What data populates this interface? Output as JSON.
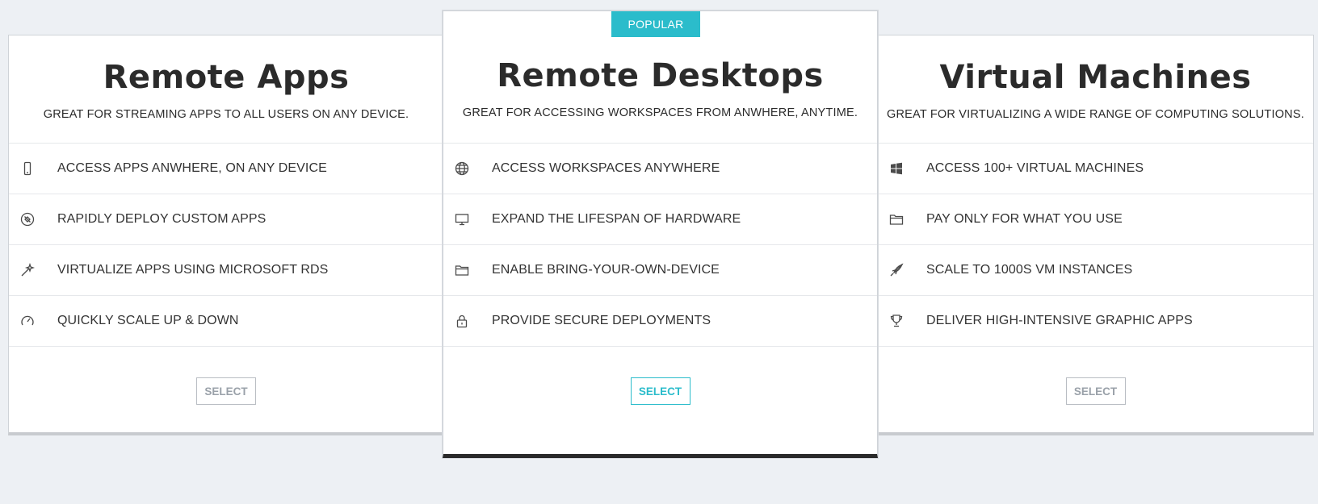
{
  "colors": {
    "accent": "#2bbccb",
    "background": "#edf0f4",
    "card": "#ffffff",
    "dark_bar": "#2a2a2a"
  },
  "plans": [
    {
      "title": "Remote Apps",
      "subtitle": "GREAT FOR STREAMING APPS TO ALL USERS ON ANY DEVICE.",
      "features": [
        {
          "icon": "mobile-icon",
          "label": "ACCESS APPS ANWHERE, ON ANY DEVICE"
        },
        {
          "icon": "compass-icon",
          "label": "RAPIDLY DEPLOY CUSTOM APPS"
        },
        {
          "icon": "magic-wand-icon",
          "label": "VIRTUALIZE APPS USING MICROSOFT RDS"
        },
        {
          "icon": "speedometer-icon",
          "label": "QUICKLY SCALE UP & DOWN"
        }
      ],
      "button": "SELECT"
    },
    {
      "badge": "POPULAR",
      "title": "Remote Desktops",
      "subtitle": "GREAT FOR ACCESSING WORKSPACES FROM ANWHERE, ANYTIME.",
      "features": [
        {
          "icon": "globe-icon",
          "label": "ACCESS WORKSPACES ANYWHERE"
        },
        {
          "icon": "monitor-icon",
          "label": "EXPAND THE LIFESPAN OF HARDWARE"
        },
        {
          "icon": "folder-icon",
          "label": "ENABLE BRING-YOUR-OWN-DEVICE"
        },
        {
          "icon": "lock-icon",
          "label": "PROVIDE SECURE DEPLOYMENTS"
        }
      ],
      "button": "SELECT"
    },
    {
      "title": "Virtual Machines",
      "subtitle": "GREAT FOR VIRTUALIZING A WIDE RANGE OF COMPUTING SOLUTIONS.",
      "features": [
        {
          "icon": "windows-icon",
          "label": "ACCESS 100+ VIRTUAL MACHINES"
        },
        {
          "icon": "folder-icon",
          "label": "PAY ONLY FOR WHAT YOU USE"
        },
        {
          "icon": "rocket-icon",
          "label": "SCALE TO 1000S VM INSTANCES"
        },
        {
          "icon": "trophy-icon",
          "label": "DELIVER HIGH-INTENSIVE GRAPHIC APPS"
        }
      ],
      "button": "SELECT"
    }
  ]
}
